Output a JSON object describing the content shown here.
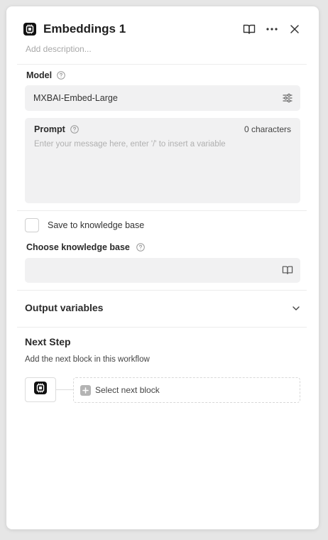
{
  "header": {
    "title": "Embeddings 1",
    "icons": {
      "block": "embeddings-chip-icon",
      "docs": "book-icon",
      "more": "more-horizontal-icon",
      "close": "close-icon"
    }
  },
  "description": {
    "placeholder": "Add description..."
  },
  "model": {
    "label": "Model",
    "selected": "MXBAI-Embed-Large",
    "icon": "sliders-icon"
  },
  "prompt": {
    "label": "Prompt",
    "char_count": "0 characters",
    "placeholder": "Enter your message here, enter '/' to insert a variable"
  },
  "save_kb": {
    "label": "Save to knowledge base",
    "checked": false
  },
  "choose_kb": {
    "label": "Choose knowledge base",
    "value": "",
    "icon": "book-icon"
  },
  "output": {
    "label": "Output variables",
    "icon": "chevron-down-icon"
  },
  "next_step": {
    "title": "Next Step",
    "subtitle": "Add the next block in this workflow",
    "select_label": "Select next block"
  },
  "colors": {
    "panel_bg": "#ffffff",
    "field_bg": "#f1f1f2",
    "page_bg": "#e6e6e6",
    "text": "#1f1f1f",
    "muted": "#a8a8a8"
  }
}
